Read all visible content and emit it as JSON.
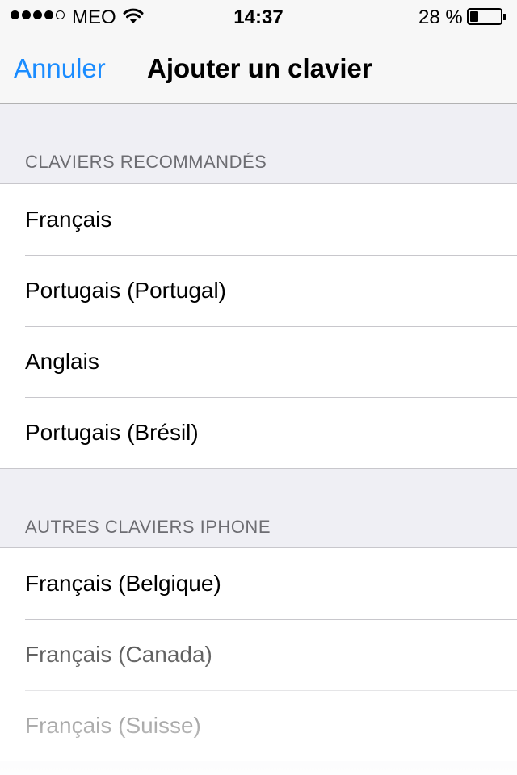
{
  "status_bar": {
    "signal_bars_filled": 4,
    "signal_bars_total": 5,
    "carrier": "MEO",
    "time": "14:37",
    "battery_percent_label": "28 %",
    "battery_level": 0.28
  },
  "nav": {
    "cancel_label": "Annuler",
    "title": "Ajouter un clavier"
  },
  "sections": [
    {
      "header": "CLAVIERS RECOMMANDÉS",
      "items": [
        "Français",
        "Portugais (Portugal)",
        "Anglais",
        "Portugais (Brésil)"
      ]
    },
    {
      "header": "AUTRES CLAVIERS IPHONE",
      "items": [
        "Français (Belgique)",
        "Français (Canada)",
        "Français (Suisse)"
      ]
    }
  ],
  "colors": {
    "accent": "#1a8cff",
    "background": "#efeff4",
    "section_header": "#6d6d72"
  },
  "icons": {
    "wifi": "wifi-icon",
    "battery": "battery-icon",
    "signal": "signal-strength-icon"
  }
}
